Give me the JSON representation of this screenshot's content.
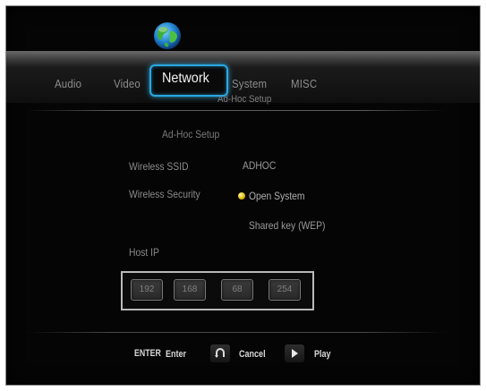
{
  "menu": {
    "tabs": [
      {
        "label": "Audio"
      },
      {
        "label": "Video"
      },
      {
        "label": "Network"
      },
      {
        "label": "System"
      },
      {
        "label": "MISC"
      }
    ],
    "active": "Network"
  },
  "page": {
    "subtitle": "Ad-Hoc Setup",
    "section_title": "Ad-Hoc Setup"
  },
  "form": {
    "ssid_label": "Wireless SSID",
    "ssid_value": "ADHOC",
    "security_label": "Wireless Security",
    "security_options": [
      "Open System",
      "Shared key (WEP)"
    ],
    "security_selected": "Open System",
    "host_ip_label": "Host IP",
    "host_ip": [
      "192",
      "168",
      "68",
      "254"
    ]
  },
  "hints": {
    "enter_key": "ENTER",
    "enter_label": "Enter",
    "cancel_label": "Cancel",
    "play_label": "Play"
  },
  "colors": {
    "accent": "#2aa8e0",
    "radio": "#e1b800"
  },
  "icons": {
    "network": "globe-icon",
    "cancel": "return-arrow-icon",
    "play": "play-icon"
  }
}
